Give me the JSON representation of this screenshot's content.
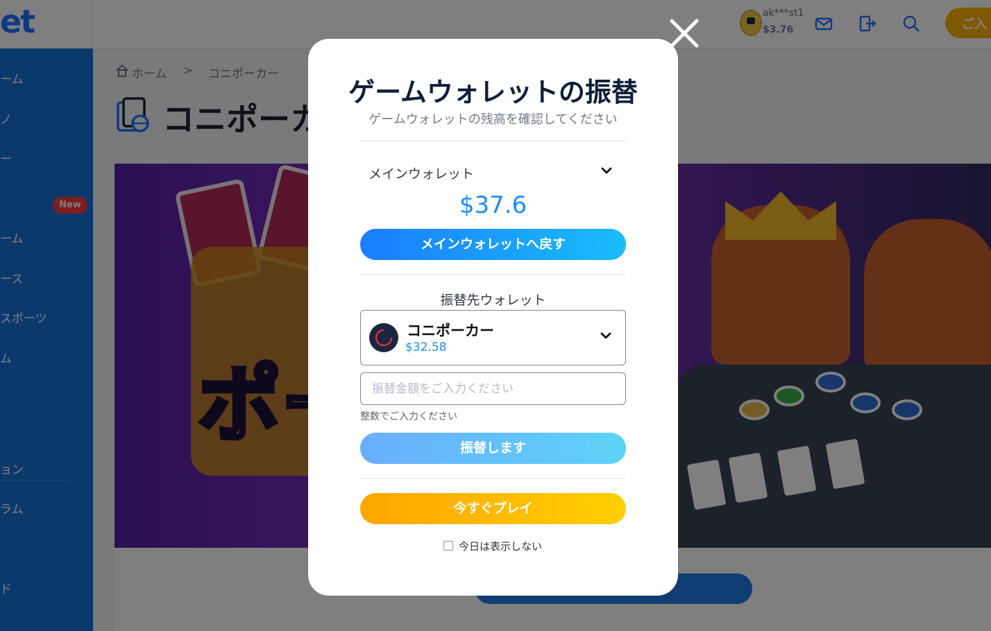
{
  "header": {
    "logo_text": "et",
    "user_name": "ak***st1",
    "user_balance": "$3.76",
    "deposit_label": "ご入"
  },
  "sidebar": {
    "items": [
      {
        "label": "ーム"
      },
      {
        "label": "ノ"
      },
      {
        "label": "ー"
      },
      {
        "label": "ーム"
      },
      {
        "label": "ース"
      },
      {
        "label": "スポーツ"
      },
      {
        "label": "ム"
      },
      {
        "label": "ョン"
      },
      {
        "label": "ラム"
      },
      {
        "label": "ド"
      }
    ],
    "new_badge": "New"
  },
  "breadcrumb": {
    "home": "ホーム",
    "separator": ">",
    "current": "コニポーカー"
  },
  "page": {
    "title": "コニポーカー",
    "banner_text": "ポー"
  },
  "modal": {
    "title": "ゲームウォレットの振替",
    "subtitle": "ゲームウォレットの残高を確認してください",
    "main_wallet_label": "メインウォレット",
    "main_wallet_amount": "$37.6",
    "return_button": "メインウォレットへ戻す",
    "target_wallet_label": "振替先ウォレット",
    "target_wallet_name": "コニポーカー",
    "target_wallet_balance": "$32.58",
    "amount_placeholder": "振替金額をご入力ください",
    "amount_value": "",
    "amount_hint": "整数でご入力ください",
    "transfer_button": "振替します",
    "play_button": "今すぐプレイ",
    "dont_show_label": "今日は表示しない",
    "dont_show_checked": false
  },
  "colors": {
    "primary_blue": "#1d8df0",
    "play_orange": "#ffa500",
    "sidebar_blue": "#1673d8",
    "title_navy": "#0d1f3a"
  },
  "icons": [
    "home-icon",
    "mail-icon",
    "logout-icon",
    "search-icon",
    "chevron-down-icon",
    "close-icon",
    "game-wallet-icon",
    "koni-poker-logo-icon"
  ]
}
